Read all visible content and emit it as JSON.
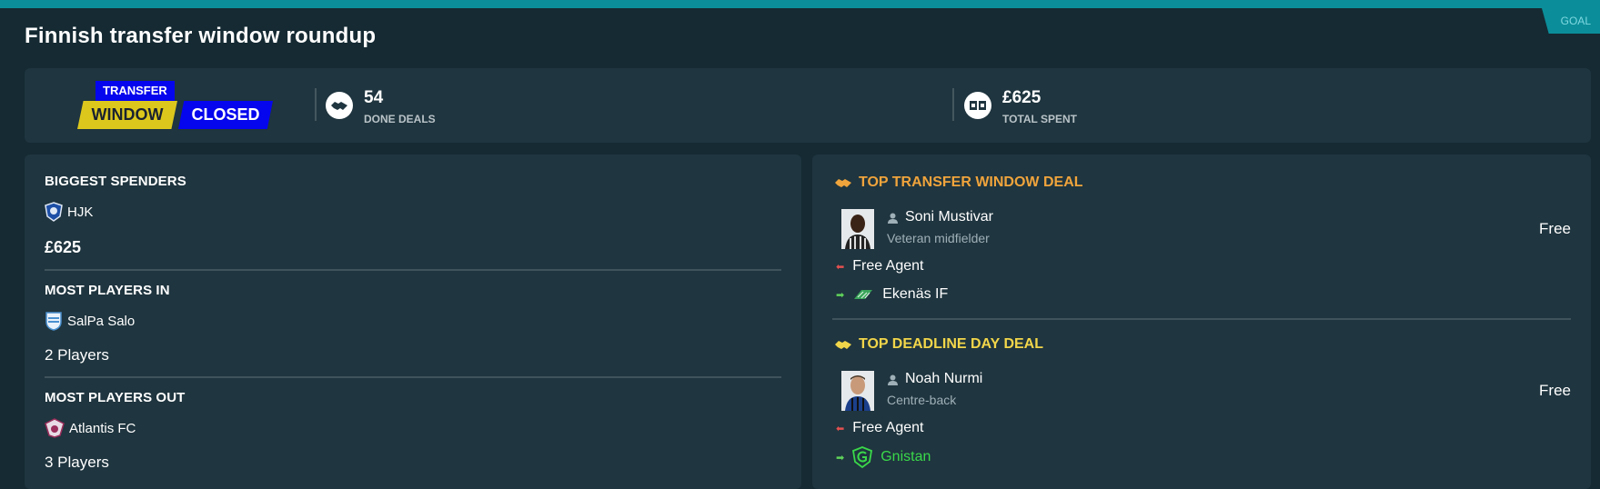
{
  "header": {
    "title": "Finnish transfer window roundup",
    "tag": "GOAL"
  },
  "summary": {
    "badge": {
      "top": "TRANSFER",
      "left": "WINDOW",
      "right": "CLOSED"
    },
    "done_deals": {
      "value": "54",
      "label": "DONE DEALS",
      "icon": "handshake-icon"
    },
    "total_spent": {
      "value": "£625",
      "label": "TOTAL SPENT",
      "icon": "money-icon"
    }
  },
  "left": {
    "biggest_spenders": {
      "title": "BIGGEST SPENDERS",
      "club": "HJK",
      "value": "£625"
    },
    "most_in": {
      "title": "MOST PLAYERS IN",
      "club": "SalPa Salo",
      "value": "2 Players"
    },
    "most_out": {
      "title": "MOST PLAYERS OUT",
      "club": "Atlantis FC",
      "value": "3 Players"
    }
  },
  "right": {
    "top_deal": {
      "title": "TOP TRANSFER WINDOW DEAL",
      "player": "Soni Mustivar",
      "role": "Veteran midfielder",
      "fee": "Free",
      "from": "Free Agent",
      "to": "Ekenäs IF"
    },
    "deadline_deal": {
      "title": "TOP DEADLINE DAY DEAL",
      "player": "Noah Nurmi",
      "role": "Centre-back",
      "fee": "Free",
      "from": "Free Agent",
      "to": "Gnistan"
    }
  },
  "colors": {
    "background": "#152a33",
    "card": "#1f353f",
    "accent_teal": "#0b8e9a",
    "deal_title_orange": "#f0a43c",
    "deal_title_yellow": "#f2d64a",
    "highlight_green": "#3ad84a",
    "badge_blue": "#0505ee",
    "badge_yellow": "#dcc81d"
  }
}
